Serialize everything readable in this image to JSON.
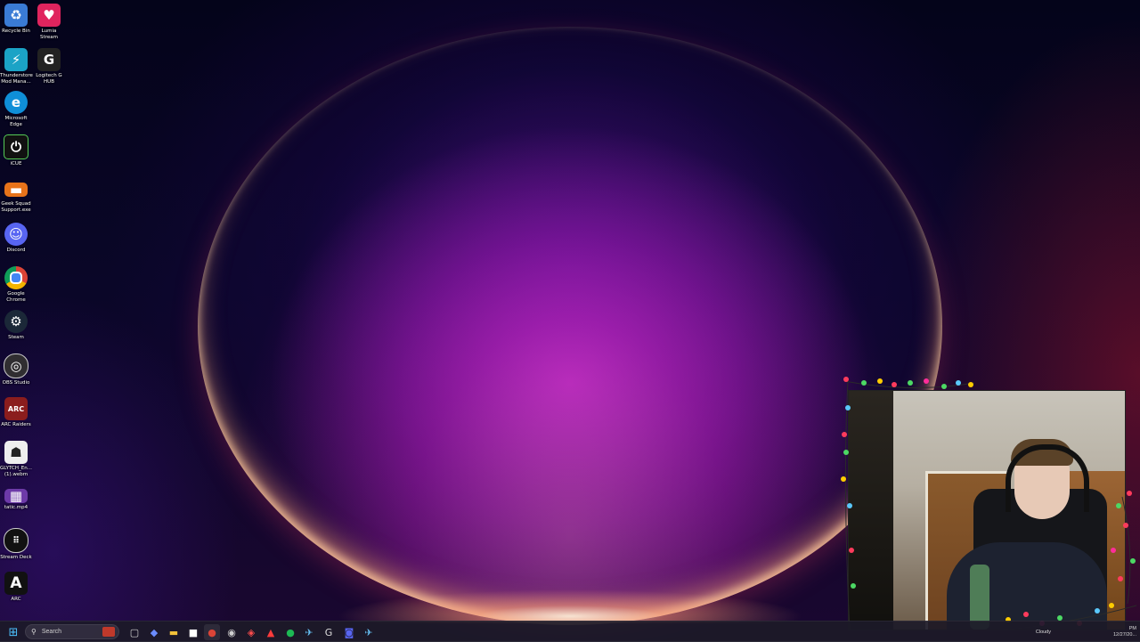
{
  "desktop_icons": [
    {
      "label": "Recycle Bin",
      "icon": "recycle-bin-icon",
      "color": "#3a7bd5"
    },
    {
      "label": "Lumia Stream",
      "icon": "lumia-stream-icon",
      "color": "#e0245e"
    },
    {
      "label": "Thunderstore Mod Mana...",
      "icon": "thunderstore-icon",
      "color": "#1ba3c6"
    },
    {
      "label": "Logitech G HUB",
      "icon": "logitech-g-hub-icon",
      "color": "#222222"
    },
    {
      "label": "Microsoft Edge",
      "icon": "edge-icon",
      "color": "#0f8fd8"
    },
    {
      "label": "iCUE",
      "icon": "icue-icon",
      "color": "#111111"
    },
    {
      "label": "Geek Squad Support.exe",
      "icon": "geek-squad-icon",
      "color": "#e8731a"
    },
    {
      "label": "Discord",
      "icon": "discord-icon",
      "color": "#5865f2"
    },
    {
      "label": "Google Chrome",
      "icon": "chrome-icon",
      "color": "#db4437"
    },
    {
      "label": "Steam",
      "icon": "steam-icon",
      "color": "#1b2838"
    },
    {
      "label": "OBS Studio",
      "icon": "obs-studio-icon",
      "color": "#302e31"
    },
    {
      "label": "ARC Raiders",
      "icon": "arc-raiders-icon",
      "color": "#8b1d1d"
    },
    {
      "label": "GLYTCH_En... (1).webm",
      "icon": "glytch-video-icon",
      "color": "#eeeeee"
    },
    {
      "label": "tatic.mp4",
      "icon": "video-file-icon",
      "color": "#6d3aa8"
    },
    {
      "label": "Stream Deck",
      "icon": "stream-deck-icon",
      "color": "#111111"
    },
    {
      "label": "ARC",
      "icon": "arc-icon",
      "color": "#111111"
    }
  ],
  "taskbar": {
    "search_label": "Search",
    "apps": [
      {
        "name": "start-button",
        "glyph": "⊞",
        "color": "#4cc2ff"
      },
      {
        "name": "task-view-button",
        "glyph": "▢",
        "color": "#cfcfcf"
      },
      {
        "name": "copilot-button",
        "glyph": "◆",
        "color": "#6b8cff"
      },
      {
        "name": "file-explorer-button",
        "glyph": "▬",
        "color": "#f3c13a"
      },
      {
        "name": "store-button",
        "glyph": "■",
        "color": "#ffffff"
      },
      {
        "name": "chrome-button",
        "glyph": "●",
        "color": "#db4437"
      },
      {
        "name": "obs-button",
        "glyph": "◉",
        "color": "#cfcfcf"
      },
      {
        "name": "app-button-8",
        "glyph": "◈",
        "color": "#ff4d4d"
      },
      {
        "name": "arc-button",
        "glyph": "▲",
        "color": "#ff3b3b"
      },
      {
        "name": "spotify-button",
        "glyph": "●",
        "color": "#1db954"
      },
      {
        "name": "steam-button",
        "glyph": "✈",
        "color": "#66c0f4"
      },
      {
        "name": "logitech-button",
        "glyph": "G",
        "color": "#dddddd"
      },
      {
        "name": "discord-button",
        "glyph": "◙",
        "color": "#5865f2"
      },
      {
        "name": "steam-button-2",
        "glyph": "✈",
        "color": "#66c0f4"
      }
    ],
    "weather": "Cloudy",
    "clock_time": "PM",
    "clock_date": "12/27/20..."
  }
}
